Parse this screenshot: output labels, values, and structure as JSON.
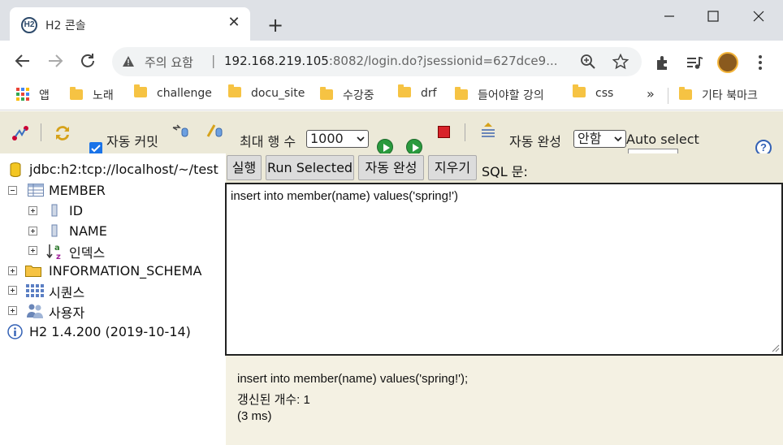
{
  "browser": {
    "tab_title": "H2 콘솔",
    "tab_favicon_text": "H2",
    "security_label": "주의 요함",
    "url_host": "192.168.219.105",
    "url_rest": ":8082/login.do?jsessionid=627dce9...",
    "bookmarks": [
      {
        "label": "앱",
        "icon": "apps-grid-icon"
      },
      {
        "label": "노래",
        "icon": "folder-icon"
      },
      {
        "label": "challenge",
        "icon": "folder-icon"
      },
      {
        "label": "docu_site",
        "icon": "folder-icon"
      },
      {
        "label": "수강중",
        "icon": "folder-icon"
      },
      {
        "label": "drf",
        "icon": "folder-icon"
      },
      {
        "label": "들어야할 강의",
        "icon": "folder-icon"
      },
      {
        "label": "css",
        "icon": "folder-icon"
      }
    ],
    "bookmarks_more": "»",
    "other_bookmarks": "기타 북마크"
  },
  "h2toolbar": {
    "autocommit_label": "자동 커밋",
    "autocommit_checked": true,
    "max_rows_label": "최대 행 수",
    "max_rows_value": "1000",
    "autocomplete_label": "자동 완성",
    "autocomplete_value": "안함",
    "auto_select_label": "Auto select",
    "help_glyph": "?"
  },
  "tree": {
    "connection": "jdbc:h2:tcp://localhost/~/test",
    "table": "MEMBER",
    "columns": [
      "ID",
      "NAME"
    ],
    "index": "인덱스",
    "schema": "INFORMATION_SCHEMA",
    "sequences": "시퀀스",
    "users": "사용자",
    "version": "H2 1.4.200 (2019-10-14)"
  },
  "sql": {
    "buttons": {
      "run": "실행",
      "run_selected": "Run Selected",
      "autocomplete": "자동 완성",
      "clear": "지우기"
    },
    "label": "SQL 문:",
    "editor_text": "insert into member(name) values('spring!')"
  },
  "result": {
    "statement": "insert into member(name) values('spring!');",
    "update_count": "갱신된 개수: 1",
    "time": "(3 ms)"
  },
  "colors": {
    "h2_panel_bg": "#ece9d8",
    "run_green": "#2a9a3e",
    "stop_red": "#d8232a",
    "folder_yellow": "#f6c343"
  }
}
